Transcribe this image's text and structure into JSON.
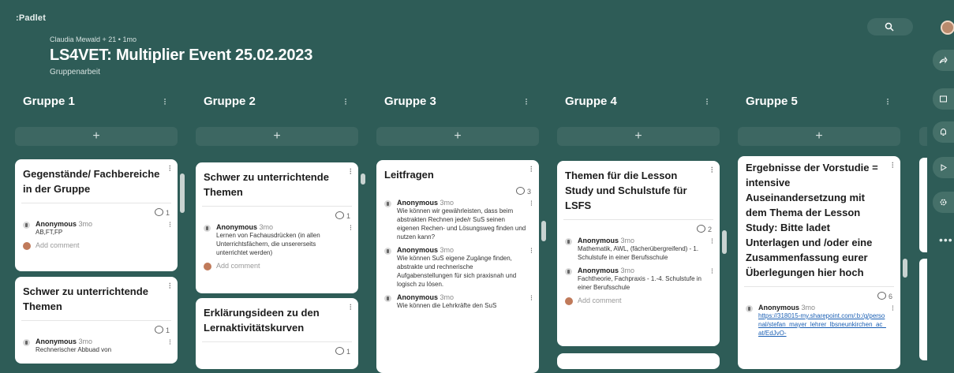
{
  "app": {
    "logo": ":Padlet"
  },
  "header": {
    "meta": "Claudia Mewald + 21 • 1mo",
    "title": "LS4VET: Multiplier Event 25.02.2023",
    "subtitle": "Gruppenarbeit"
  },
  "columns": [
    {
      "label": "Gruppe 1",
      "add": "+"
    },
    {
      "label": "Gruppe 2",
      "add": "+"
    },
    {
      "label": "Gruppe 3",
      "add": "+"
    },
    {
      "label": "Gruppe 4",
      "add": "+"
    },
    {
      "label": "Gruppe 5",
      "add": "+"
    }
  ],
  "cards": {
    "g1a": {
      "title": "Gegenstände/ Fachbereiche in der Gruppe",
      "count": "1",
      "author": "Anonymous",
      "time": "3mo",
      "body": "AB,FT,FP",
      "add_comment": "Add comment"
    },
    "g1b": {
      "title": "Schwer zu unterrichtende Themen",
      "count": "1",
      "author": "Anonymous",
      "time": "3mo",
      "body": "Rechnerischer Abbuad von"
    },
    "g2a": {
      "title": "Schwer zu unterrichtende Themen",
      "count": "1",
      "author": "Anonymous",
      "time": "3mo",
      "body": "Lernen von Fachausdrücken (in allen Unterrichtsfächern, die unsererseits unterrichtet werden)",
      "add_comment": "Add comment"
    },
    "g2b": {
      "title": "Erklärungsideen zu den Lernaktivitätskurven",
      "count": "1"
    },
    "g3a": {
      "title": "Leitfragen",
      "count": "3",
      "comments": [
        {
          "author": "Anonymous",
          "time": "3mo",
          "body": "Wie können wir gewährleisten, dass beim abstrakten Rechnen jede/r SuS seinen eigenen Rechen- und Lösungsweg finden und nutzen kann?"
        },
        {
          "author": "Anonymous",
          "time": "3mo",
          "body": "Wie können SuS eigene Zugänge finden, abstrakte und rechnerische Aufgabenstellungen für sich praxisnah und logisch zu lösen."
        },
        {
          "author": "Anonymous",
          "time": "3mo",
          "body": "Wie können die Lehrkräfte den SuS"
        }
      ]
    },
    "g4a": {
      "title": "Themen für die Lesson Study und Schulstufe für LSFS",
      "count": "2",
      "comments": [
        {
          "author": "Anonymous",
          "time": "3mo",
          "body": "Mathematik, AWL, (fächerübergreifend) - 1. Schulstufe in einer Berufsschule"
        },
        {
          "author": "Anonymous",
          "time": "3mo",
          "body": "Fachtheorie, Fachpraxis - 1.-4. Schulstufe in einer Berufsschule"
        }
      ],
      "add_comment": "Add comment"
    },
    "g5a": {
      "title": "Ergebnisse der Vorstudie = intensive Auseinandersetzung mit dem Thema der Lesson Study: Bitte ladet Unterlagen und /oder eine Zusammenfassung eurer Überlegungen hier hoch",
      "count": "6",
      "author": "Anonymous",
      "time": "3mo",
      "body": "https://318015-my.sharepoint.com/:b:/g/personal/stefan_mayer_lehrer_lbsneunkirchen_ac_at/EdJvO-"
    }
  },
  "icons": {
    "search": "search-icon",
    "share": "share-icon",
    "remix": "remix-icon",
    "notify": "bell-icon",
    "slideshow": "play-icon",
    "settings": "gear-icon",
    "more": "more-icon"
  },
  "colors": {
    "background": "#2e5c57",
    "card": "#ffffff",
    "link": "#1a5fb4"
  }
}
